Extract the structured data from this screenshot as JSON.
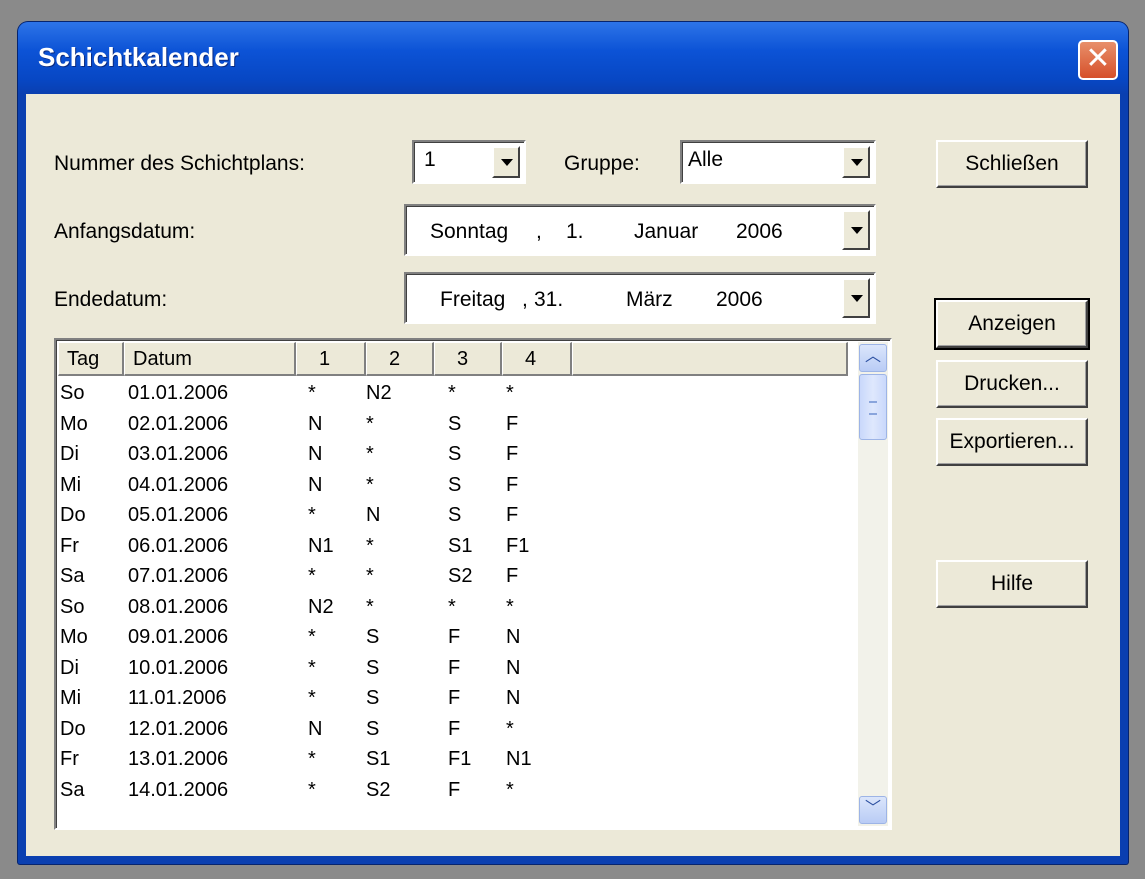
{
  "window": {
    "title": "Schichtkalender",
    "close_glyph": "✕"
  },
  "form": {
    "plan_label": "Nummer des Schichtplans:",
    "plan_value": "1",
    "group_label": "Gruppe:",
    "group_value": "Alle",
    "start_label": "Anfangsdatum:",
    "start_date": {
      "weekday": "Sonntag",
      "sep": ",",
      "day": "1.",
      "month": "Januar",
      "year": "2006"
    },
    "end_label": "Endedatum:",
    "end_date": {
      "weekday": "Freitag",
      "sep": ",",
      "day": "31.",
      "month": "März",
      "year": "2006"
    }
  },
  "buttons": {
    "close": "Schließen",
    "show": "Anzeigen",
    "print": "Drucken...",
    "export": "Exportieren...",
    "help": "Hilfe"
  },
  "table": {
    "columns": [
      "Tag",
      "Datum",
      "1",
      "2",
      "3",
      "4"
    ],
    "rows": [
      [
        "So",
        "01.01.2006",
        "*",
        "N2",
        "*",
        "*"
      ],
      [
        "Mo",
        "02.01.2006",
        "N",
        "*",
        "S",
        "F"
      ],
      [
        "Di",
        "03.01.2006",
        "N",
        "*",
        "S",
        "F"
      ],
      [
        "Mi",
        "04.01.2006",
        "N",
        "*",
        "S",
        "F"
      ],
      [
        "Do",
        "05.01.2006",
        "*",
        "N",
        "S",
        "F"
      ],
      [
        "Fr",
        "06.01.2006",
        "N1",
        "*",
        "S1",
        "F1"
      ],
      [
        "Sa",
        "07.01.2006",
        "*",
        "*",
        "S2",
        "F"
      ],
      [
        "So",
        "08.01.2006",
        "N2",
        "*",
        "*",
        "*"
      ],
      [
        "Mo",
        "09.01.2006",
        "*",
        "S",
        "F",
        "N"
      ],
      [
        "Di",
        "10.01.2006",
        "*",
        "S",
        "F",
        "N"
      ],
      [
        "Mi",
        "11.01.2006",
        "*",
        "S",
        "F",
        "N"
      ],
      [
        "Do",
        "12.01.2006",
        "N",
        "S",
        "F",
        "*"
      ],
      [
        "Fr",
        "13.01.2006",
        "*",
        "S1",
        "F1",
        "N1"
      ],
      [
        "Sa",
        "14.01.2006",
        "*",
        "S2",
        "F",
        "*"
      ]
    ]
  },
  "icons": {
    "scroll_up": "chevron-up-icon",
    "scroll_down": "chevron-down-icon",
    "dropdown": "dropdown-arrow-icon",
    "close": "close-icon"
  }
}
